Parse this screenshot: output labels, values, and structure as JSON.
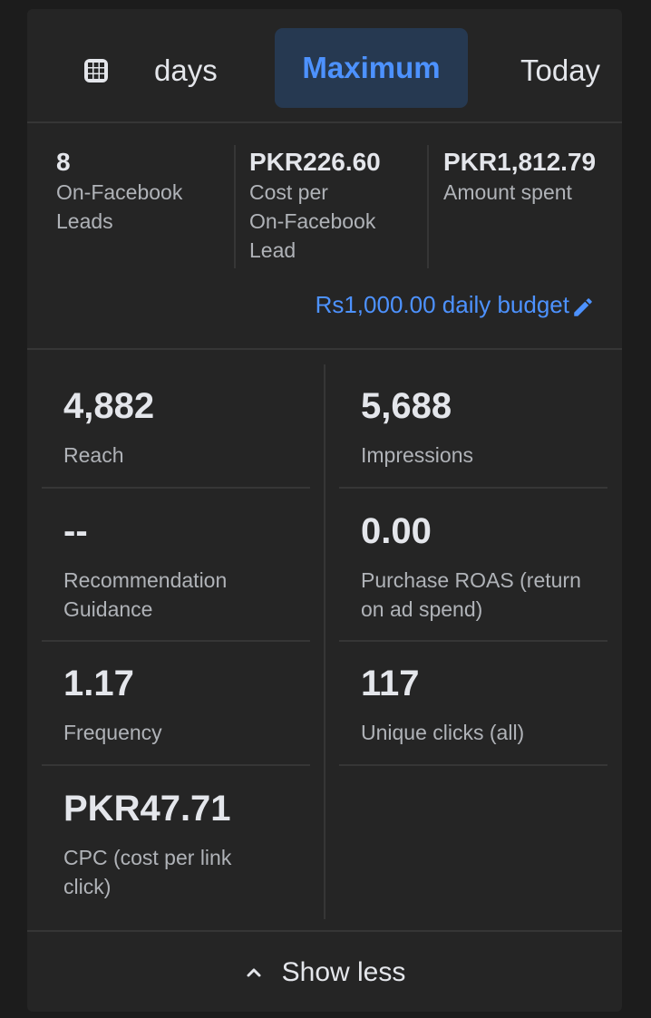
{
  "tabs": {
    "items": [
      {
        "label": "days"
      },
      {
        "label": "Maximum",
        "selected": true
      },
      {
        "label": "Today"
      }
    ],
    "calendar_icon": "calendar-grid-icon"
  },
  "summary": {
    "metrics": [
      {
        "value": "8",
        "label_lines": [
          "On-Facebook",
          "Leads"
        ]
      },
      {
        "value": "PKR226.60",
        "label_lines": [
          "Cost per",
          "On-Facebook",
          "Lead"
        ]
      },
      {
        "value": "PKR1,812.79",
        "label_lines": [
          "Amount spent"
        ]
      }
    ],
    "budget_label": "Rs1,000.00 daily budget",
    "edit_icon": "pencil-icon"
  },
  "grid": {
    "cells": [
      {
        "value": "4,882",
        "label_lines": [
          "Reach"
        ]
      },
      {
        "value": "5,688",
        "label_lines": [
          "Impressions"
        ]
      },
      {
        "value": "--",
        "label_lines": [
          "Recommendation",
          "Guidance"
        ]
      },
      {
        "value": "0.00",
        "label_lines": [
          "Purchase ROAS (return",
          "on ad spend)"
        ]
      },
      {
        "value": "1.17",
        "label_lines": [
          "Frequency"
        ]
      },
      {
        "value": "117",
        "label_lines": [
          "Unique clicks (all)"
        ]
      },
      {
        "value": "PKR47.71",
        "label_lines": [
          "CPC (cost per link",
          "click)"
        ]
      }
    ]
  },
  "footer": {
    "show_less_label": "Show less",
    "chevron_icon": "chevron-up-icon"
  },
  "colors": {
    "accent": "#4d92ff",
    "selected_tab_bg": "#263951",
    "card_bg": "#252525",
    "page_bg": "#1c1c1c",
    "primary_text": "#e4e6eb",
    "secondary_text": "#b0b3b8"
  }
}
